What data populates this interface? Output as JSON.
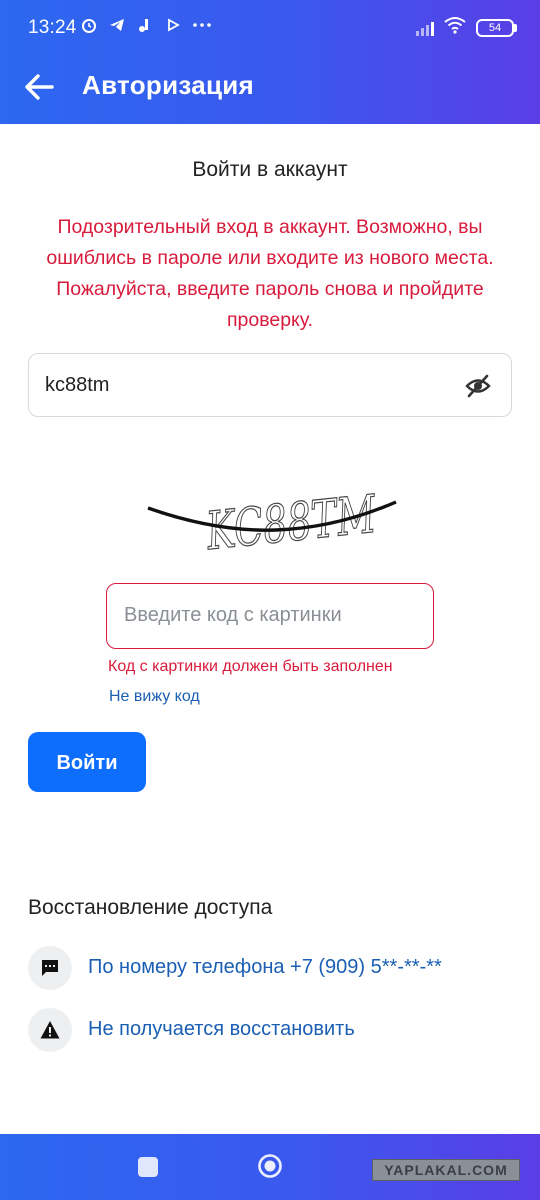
{
  "status_bar": {
    "time": "13:24",
    "battery": "54",
    "left_icons": [
      "alarm-icon",
      "telegram-icon",
      "notification-icon",
      "play-icon",
      "more-icon"
    ],
    "right_icons": [
      "signal-icon",
      "wifi-icon",
      "battery-icon"
    ]
  },
  "app_bar": {
    "title": "Авторизация",
    "back_icon": "arrow-left-icon"
  },
  "login": {
    "heading": "Войти в аккаунт",
    "warning": "Подозрительный вход в аккаунт. Возможно, вы ошиблись в пароле или входите из нового места. Пожалуйста, введите пароль снова и пройдите проверку.",
    "password_value": "kc88tm",
    "eye_icon": "eye-off-icon",
    "captcha_text": "KC88TM",
    "captcha_placeholder": "Введите код с картинки",
    "captcha_error": "Код с картинки должен быть заполнен",
    "no_code_link": "Не вижу код",
    "submit_label": "Войти"
  },
  "recovery": {
    "heading": "Восстановление доступа",
    "items": [
      {
        "label": "По номеру телефона +7 (909) 5**-**-**",
        "icon": "message-icon"
      },
      {
        "label": "Не получается восстановить",
        "icon": "warning-icon"
      }
    ]
  },
  "navigation": {
    "recents_icon": "square-icon",
    "home_icon": "circle-icon",
    "watermark": "YAPLAKAL.COM"
  },
  "colors": {
    "header_start": "#2c68f0",
    "header_end": "#5a3ee6",
    "error": "#d81b3c",
    "link": "#1a5fb4",
    "primary_button": "#0d6efd"
  }
}
